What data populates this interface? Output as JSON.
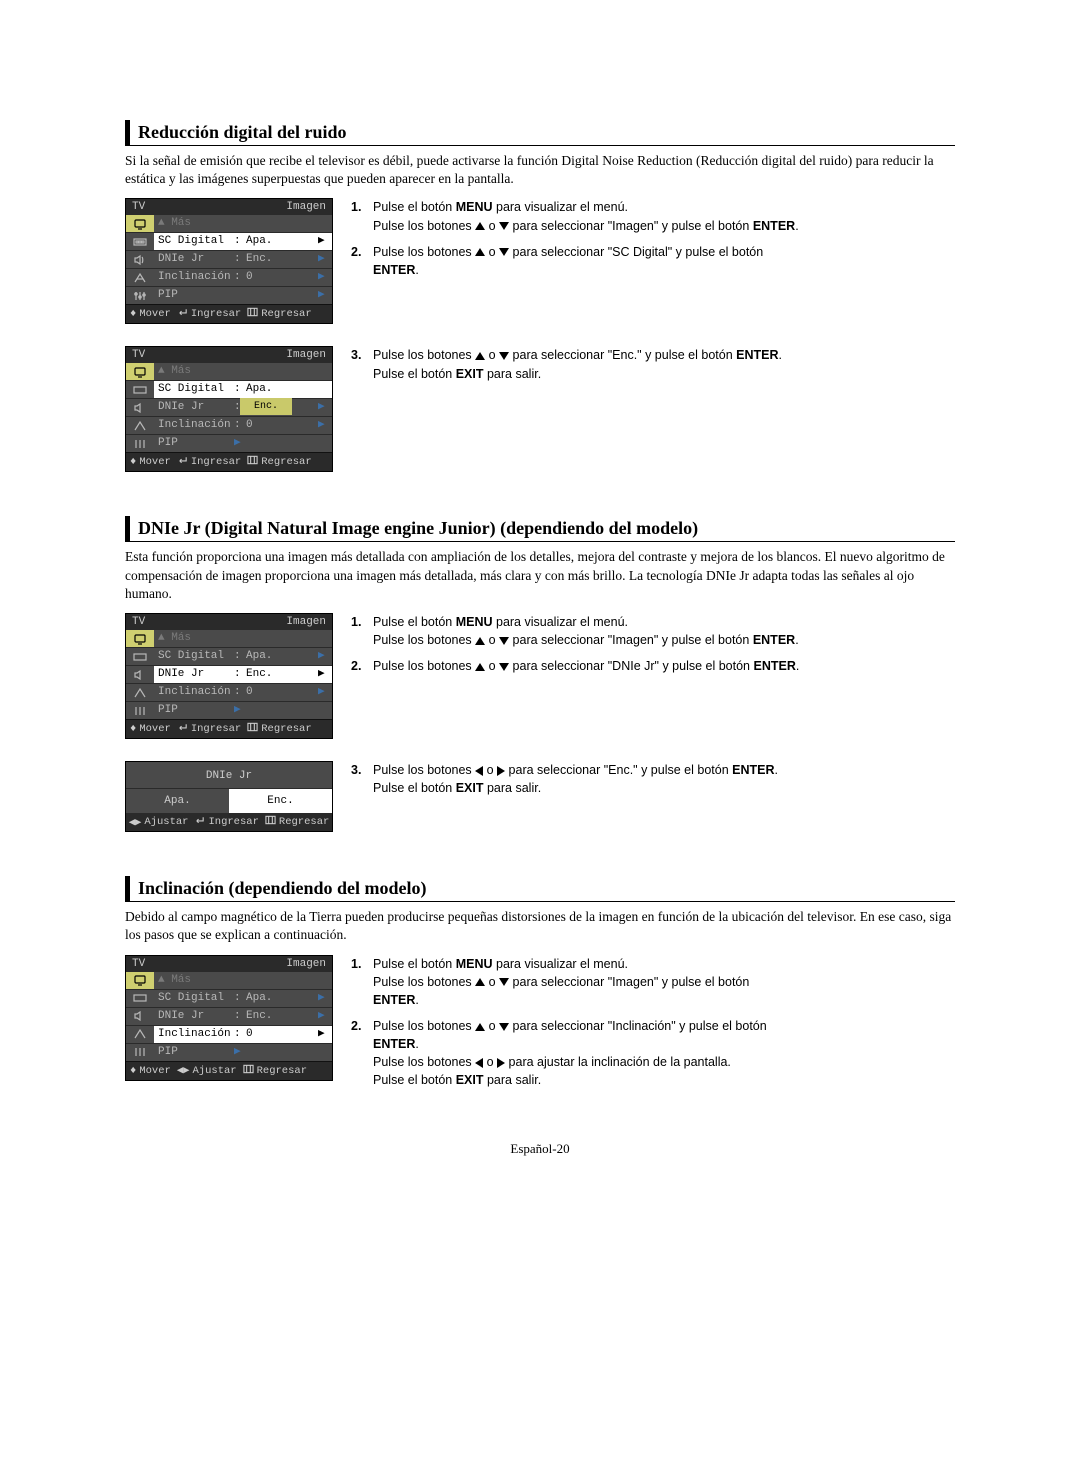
{
  "sections": [
    {
      "title": "Reducción digital del ruido",
      "intro": "Si la señal de emisión que recibe el televisor es débil, puede activarse la función Digital Noise Reduction (Reducción digital del ruido) para reducir la estática y las imágenes superpuestas que pueden aparecer en la pantalla.",
      "step1_a": "Pulse el botón ",
      "step1_b": "MENU",
      "step1_c": " para visualizar el menú.",
      "step1_d": "Pulse los botones ",
      "step1_e": " para seleccionar \"Imagen\" y pulse el botón ",
      "step1_f": "ENTER",
      "step2_a": "Pulse los botones ",
      "step2_b": " para seleccionar \"SC Digital\" y pulse el botón ",
      "step2_c": "ENTER",
      "step3_a": "Pulse los botones ",
      "step3_b": " para seleccionar \"Enc.\" y pulse el botón ",
      "step3_c": "ENTER",
      "step3_d": "Pulse el botón ",
      "step3_e": "EXIT",
      "step3_f": " para salir."
    },
    {
      "title": "DNIe Jr (Digital Natural Image engine Junior) (dependiendo del modelo)",
      "intro": "Esta función proporciona una imagen más detallada con ampliación de los detalles, mejora del contraste y mejora de los blancos. El nuevo algoritmo de compensación de imagen proporciona una imagen más detallada, más clara y con más brillo. La tecnología DNIe Jr adapta todas las señales al ojo humano.",
      "step1_a": "Pulse el botón ",
      "step1_b": "MENU",
      "step1_c": " para visualizar el menú.",
      "step1_d": "Pulse los botones ",
      "step1_e": " para seleccionar \"Imagen\" y pulse el botón ",
      "step1_f": "ENTER",
      "step2_a": "Pulse los botones ",
      "step2_b": " para seleccionar \"DNIe Jr\" y pulse el botón ",
      "step2_c": "ENTER",
      "step3_a": "Pulse los botones ",
      "step3_b": " para seleccionar \"Enc.\" y pulse el botón ",
      "step3_c": "ENTER",
      "step3_d": "Pulse el botón ",
      "step3_e": "EXIT",
      "step3_f": " para salir."
    },
    {
      "title": "Inclinación (dependiendo del modelo)",
      "intro": "Debido al campo magnético de la Tierra pueden producirse pequeñas distorsiones de la imagen en función de la ubicación del televisor. En ese caso, siga los pasos que se explican a continuación.",
      "step1_a": "Pulse el botón ",
      "step1_b": "MENU",
      "step1_c": " para visualizar el menú.",
      "step1_d": "Pulse los botones ",
      "step1_e": " para seleccionar \"Imagen\" y pulse el botón ",
      "step1_f": "ENTER",
      "step2_a": "Pulse los botones ",
      "step2_b": " para seleccionar \"Inclinación\" y pulse el botón ",
      "step2_c": "ENTER",
      "step2_d": "Pulse los botones ",
      "step2_e": " para ajustar la inclinación de la pantalla.",
      "step2_f": "Pulse el botón ",
      "step2_g": "EXIT",
      "step2_h": " para salir."
    }
  ],
  "menu": {
    "tv": "TV",
    "title": "Imagen",
    "mas": "▲ Más",
    "items": {
      "sc": {
        "label": "SC Digital",
        "val": "Apa."
      },
      "dn": {
        "label": "DNIe Jr",
        "val": "Enc."
      },
      "in": {
        "label": "Inclinación",
        "val": "0"
      },
      "pip": {
        "label": "PIP",
        "val": ""
      }
    },
    "enc": "Enc.",
    "apa": "Apa.",
    "ftr": {
      "mover": "Mover",
      "ingresar": "Ingresar",
      "regresar": "Regresar",
      "ajustar": "Ajustar"
    }
  },
  "dniebox": {
    "title": "DNIe Jr",
    "apa": "Apa.",
    "enc": "Enc."
  },
  "or": " o ",
  "dot": ".",
  "footer": "Español-20"
}
